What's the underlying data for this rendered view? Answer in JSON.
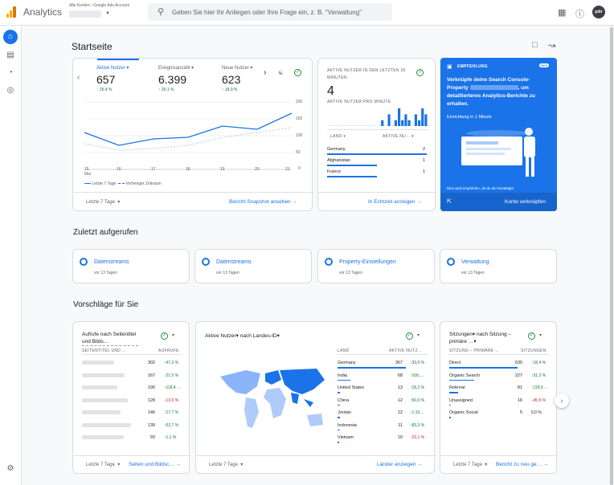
{
  "topbar": {
    "app_title": "Analytics",
    "breadcrumb": "Alle Konten › Google Ads Account",
    "search_placeholder": "Geben Sie hier Ihr Anliegen oder Ihre Frage ein, z. B. \"Verwaltung\"",
    "avatar_initials": "pdir"
  },
  "page": {
    "title": "Startseite"
  },
  "overview": {
    "metrics": [
      {
        "label": "Aktive Nutzer",
        "value": "657",
        "delta": "25,4 %"
      },
      {
        "label": "Ereignisanzahl",
        "value": "6.399",
        "delta": "26,1 %"
      },
      {
        "label": "Neue Nutzer",
        "value": "623",
        "delta": "18,9 %"
      }
    ],
    "legend_current": "Letzte 7 Tage",
    "legend_previous": "Vorheriger Zeitraum",
    "range": "Letzte 7 Tage",
    "footer_link": "Bericht-Snapshot ansehen",
    "x_ticks": [
      "15",
      "16",
      "17",
      "18",
      "19",
      "20",
      "21"
    ],
    "x_month": "Mai",
    "y_ticks": [
      "200",
      "150",
      "100",
      "50",
      "0"
    ]
  },
  "realtime": {
    "title": "AKTIVE NUTZER IN DEN LETZTEN 30 MINUTEN",
    "value": "4",
    "subtitle": "AKTIVE NUTZER PRO MINUTE",
    "col_country": "LAND",
    "col_users": "AKTIVE NU…",
    "rows": [
      {
        "country": "Germany",
        "users": "2",
        "fill": 1.0
      },
      {
        "country": "Afghanistan",
        "users": "1",
        "fill": 0.5
      },
      {
        "country": "France",
        "users": "1",
        "fill": 0.5
      }
    ],
    "minute_bars": [
      0,
      0,
      0,
      0,
      0,
      0,
      0,
      0,
      0,
      0,
      0,
      0,
      0,
      0,
      0,
      0,
      1,
      0,
      2,
      0,
      1,
      3,
      1,
      2,
      1,
      0,
      2,
      1,
      3,
      2
    ],
    "footer_link": "In Echtzeit anzeigen"
  },
  "recommendation": {
    "label": "EMPFEHLUNG",
    "badge": "Neu",
    "text_start": "Verknüpfe deine Search Console-Property",
    "text_end": ", um detaillierteres Analytics-Berichte zu erhalten.",
    "sub": "Einrichtung in 1 Minute",
    "note": "Dies wird empfohlen, da du der bestätigte",
    "action": "Konto verknüpfen"
  },
  "recent": {
    "title": "Zuletzt aufgerufen",
    "items": [
      {
        "title": "Datenstreams",
        "sub": "vor 13 Tagen"
      },
      {
        "title": "Datenstreams",
        "sub": "vor 13 Tagen"
      },
      {
        "title": "Property-Einstellungen",
        "sub": "vor 13 Tagen"
      },
      {
        "title": "Verwaltung",
        "sub": "vor 13 Tagen"
      }
    ]
  },
  "suggestions": {
    "title": "Vorschläge für Sie",
    "card1": {
      "title": "Aufrufe nach Seitentitel und Bilds…",
      "col1": "SEITENTITEL UND …",
      "col2": "AUFRUFE",
      "rows": [
        {
          "value": "302",
          "delta": "47,3 %",
          "dir": "up"
        },
        {
          "value": "167",
          "delta": "21,0 %",
          "dir": "up"
        },
        {
          "value": "190",
          "delta": "118,4 …",
          "dir": "up"
        },
        {
          "value": "128",
          "delta": "13,5 %",
          "dir": "down"
        },
        {
          "value": "146",
          "delta": "17,7 %",
          "dir": "up"
        },
        {
          "value": "139",
          "delta": "52,7 %",
          "dir": "up"
        },
        {
          "value": "93",
          "delta": "1,1 %",
          "dir": "up"
        }
      ],
      "range": "Letzte 7 Tage",
      "link": "Seiten und Bildsc…"
    },
    "card2": {
      "title_a": "Aktive Nutzer",
      "title_b": "nach Landes-ID",
      "col1": "LAND",
      "col2": "AKTIVE NUTZ…",
      "rows": [
        {
          "country": "Germany",
          "value": "367",
          "delta": "33,0 %",
          "dir": "up"
        },
        {
          "country": "India",
          "value": "68",
          "delta": "100,…",
          "dir": "up"
        },
        {
          "country": "United States",
          "value": "13",
          "delta": "18,2 %",
          "dir": "up"
        },
        {
          "country": "China",
          "value": "12",
          "delta": "50,0 %",
          "dir": "up"
        },
        {
          "country": "Jordan",
          "value": "12",
          "delta": "1.10…",
          "dir": "up"
        },
        {
          "country": "Indonesia",
          "value": "11",
          "delta": "83,3 %",
          "dir": "up"
        },
        {
          "country": "Vietnam",
          "value": "10",
          "delta": "23,1 %",
          "dir": "down"
        }
      ],
      "range": "Letzte 7 Tage",
      "link": "Länder anzeigen"
    },
    "card3": {
      "title_a": "Sitzungen",
      "title_b": "nach Sitzung – primäre …",
      "col1": "SITZUNG – PRIMÄRE …",
      "col2": "SITZUNGEN",
      "rows": [
        {
          "channel": "Direct",
          "value": "630",
          "delta": "18,4 %",
          "dir": "up"
        },
        {
          "channel": "Organic Search",
          "value": "227",
          "delta": "31,2 %",
          "dir": "up"
        },
        {
          "channel": "Referral",
          "value": "81",
          "delta": "118,9 …",
          "dir": "up"
        },
        {
          "channel": "Unassigned",
          "value": "16",
          "delta": "45,5 %",
          "dir": "down"
        },
        {
          "channel": "Organic Social",
          "value": "5",
          "delta": "0,0 %",
          "dir": "flat"
        }
      ],
      "range": "Letzte 7 Tage",
      "link": "Bericht zu neu ge…"
    }
  },
  "colors": {
    "accent": "#1a73e8",
    "up": "#137333",
    "down": "#c5221f"
  }
}
